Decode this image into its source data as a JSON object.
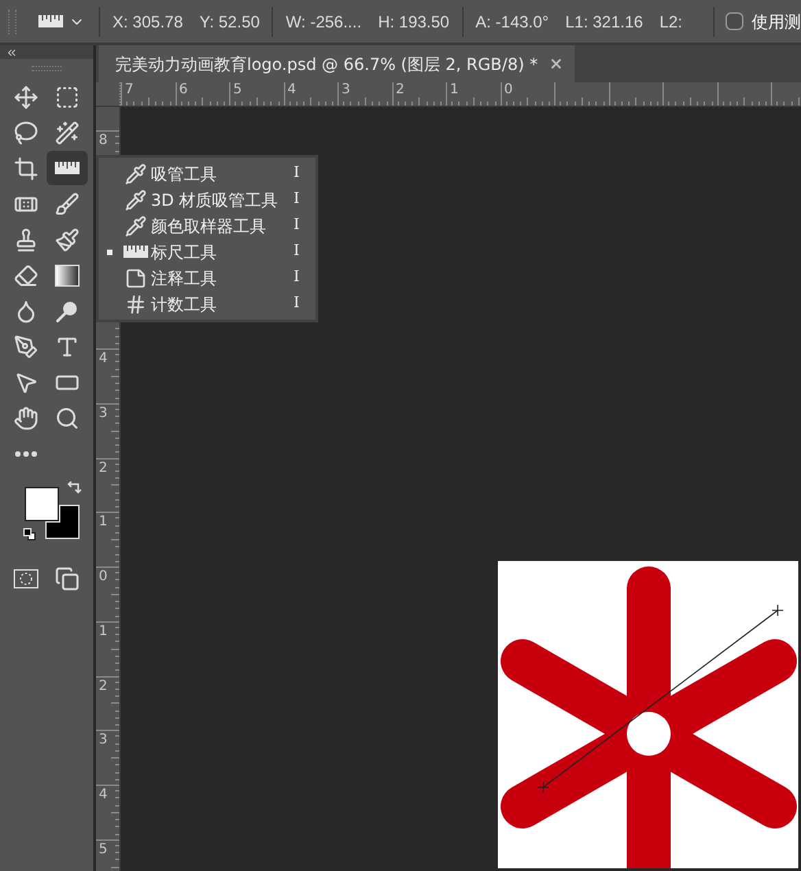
{
  "options_bar": {
    "groups": [
      [
        {
          "label": "X:",
          "value": "305.78"
        },
        {
          "label": "Y:",
          "value": "52.50"
        }
      ],
      [
        {
          "label": "W:",
          "value": "-256...."
        },
        {
          "label": "H:",
          "value": "193.50"
        }
      ],
      [
        {
          "label": "A:",
          "value": "-143.0°"
        },
        {
          "label": "L1:",
          "value": "321.16"
        },
        {
          "label": "L2:"
        }
      ]
    ],
    "checkbox": {
      "label": "使用测",
      "checked": false
    }
  },
  "tools": [
    {
      "selected": false
    },
    {
      "selected": false
    },
    {
      "selected": false
    },
    {
      "selected": false
    },
    {
      "selected": false
    },
    {
      "selected": true
    },
    {
      "selected": false
    },
    {
      "selected": false
    },
    {
      "selected": false
    },
    {
      "selected": false
    },
    {
      "selected": false
    },
    {
      "selected": false
    },
    {
      "selected": false
    },
    {
      "selected": false
    },
    {
      "selected": false
    },
    {
      "selected": false
    },
    {
      "selected": false
    },
    {
      "selected": false
    },
    {
      "selected": false
    },
    {
      "selected": false
    },
    {
      "selected": false
    }
  ],
  "swatches": [
    {
      "color": "#ffffff"
    },
    {
      "color": "#000000"
    }
  ],
  "document_tab": {
    "title": "完美动力动画教育logo.psd @ 66.7% (图层 2, RGB/8) *"
  },
  "rulers": {
    "horizontal": [
      "7",
      "6",
      "5",
      "4",
      "3",
      "2",
      "1",
      "0"
    ],
    "vertical": [
      "8",
      "4",
      "3",
      "2",
      "1",
      "0",
      "1",
      "2",
      "3",
      "4",
      "5"
    ]
  },
  "flyout_menu": {
    "items": [
      {
        "label": "吸管工具",
        "shortcut": "I",
        "selected": false
      },
      {
        "label": "3D 材质吸管工具",
        "shortcut": "I",
        "selected": false
      },
      {
        "label": "颜色取样器工具",
        "shortcut": "I",
        "selected": false
      },
      {
        "label": "标尺工具",
        "shortcut": "I",
        "selected": true
      },
      {
        "label": "注释工具",
        "shortcut": "I",
        "selected": false
      },
      {
        "label": "计数工具",
        "shortcut": "I",
        "selected": false
      }
    ]
  }
}
